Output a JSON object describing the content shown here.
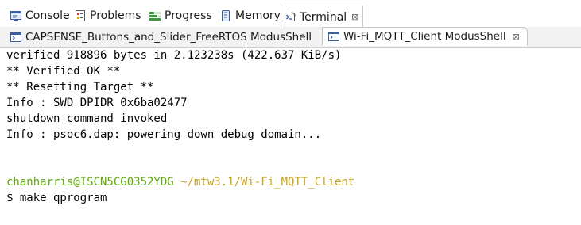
{
  "top_tabs": [
    {
      "label": "Console",
      "icon": "console-icon"
    },
    {
      "label": "Problems",
      "icon": "problems-icon"
    },
    {
      "label": "Progress",
      "icon": "progress-icon"
    },
    {
      "label": "Memory",
      "icon": "memory-icon"
    },
    {
      "label": "Terminal",
      "icon": "terminal-icon",
      "active": true,
      "close": "⊠"
    }
  ],
  "inner_tabs": [
    {
      "label": "CAPSENSE_Buttons_and_Slider_FreeRTOS ModusShell",
      "icon": "shell-icon"
    },
    {
      "label": "Wi-Fi_MQTT_Client ModusShell",
      "icon": "shell-icon",
      "active": true,
      "close": "⊠"
    }
  ],
  "terminal": {
    "lines": [
      "verified 918896 bytes in 2.123238s (422.637 KiB/s)",
      "** Verified OK **",
      "** Resetting Target **",
      "Info : SWD DPIDR 0x6ba02477",
      "shutdown command invoked",
      "Info : psoc6.dap: powering down debug domain...",
      "",
      ""
    ],
    "prompt_user": "chanharris@ISCN5CG0352YDG",
    "prompt_path": "~/mtw3.1/Wi-Fi_MQTT_Client",
    "command_line": "$ make qprogram"
  },
  "colors": {
    "prompt_user": "#5fa80a",
    "prompt_path": "#c7a322"
  }
}
